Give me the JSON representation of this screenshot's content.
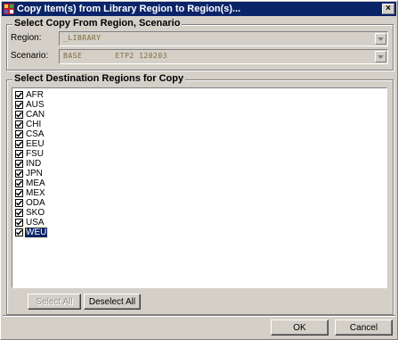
{
  "window": {
    "title": "Copy Item(s) from Library Region to Region(s)...",
    "close_glyph": "×"
  },
  "source_group": {
    "legend": "Select Copy From Region, Scenario",
    "region_label": "Region:",
    "region_value": "_LIBRARY",
    "scenario_label": "Scenario:",
    "scenario_value": "BASE       ETP2 120203"
  },
  "dest_group": {
    "legend": "Select Destination Regions for Copy",
    "regions": [
      {
        "label": "AFR",
        "checked": true
      },
      {
        "label": "AUS",
        "checked": true
      },
      {
        "label": "CAN",
        "checked": true
      },
      {
        "label": "CHI",
        "checked": true
      },
      {
        "label": "CSA",
        "checked": true
      },
      {
        "label": "EEU",
        "checked": true
      },
      {
        "label": "FSU",
        "checked": true
      },
      {
        "label": "IND",
        "checked": true
      },
      {
        "label": "JPN",
        "checked": true
      },
      {
        "label": "MEA",
        "checked": true
      },
      {
        "label": "MEX",
        "checked": true
      },
      {
        "label": "ODA",
        "checked": true
      },
      {
        "label": "SKO",
        "checked": true
      },
      {
        "label": "USA",
        "checked": true
      },
      {
        "label": "WEU",
        "checked": true,
        "selected": true
      }
    ],
    "select_all_label": "Select All",
    "deselect_all_label": "Deselect All"
  },
  "footer": {
    "ok_label": "OK",
    "cancel_label": "Cancel"
  },
  "colors": {
    "titlebar": "#0a246a",
    "background": "#ffffcc",
    "dialog": "#d4d0c8"
  }
}
